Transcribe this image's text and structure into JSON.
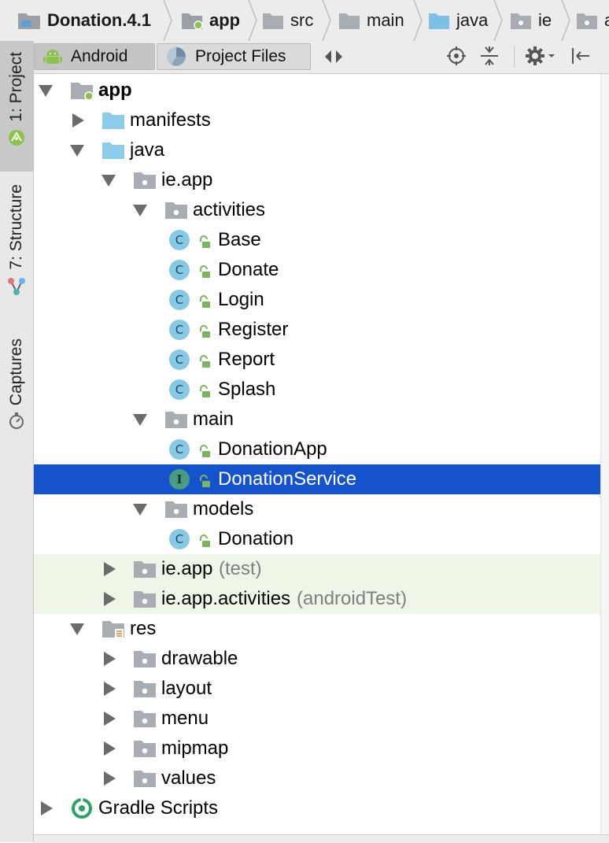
{
  "breadcrumb": [
    {
      "label": "Donation.4.1",
      "icon": "project-folder-icon",
      "bold": true
    },
    {
      "label": "app",
      "icon": "module-folder-icon",
      "bold": true
    },
    {
      "label": "src",
      "icon": "folder-icon",
      "bold": false
    },
    {
      "label": "main",
      "icon": "folder-icon",
      "bold": false
    },
    {
      "label": "java",
      "icon": "source-folder-icon",
      "bold": false
    },
    {
      "label": "ie",
      "icon": "package-icon",
      "bold": false
    },
    {
      "label": "a",
      "icon": "package-icon",
      "bold": false
    }
  ],
  "side_tabs": [
    {
      "label": "1: Project",
      "icon": "android-icon",
      "active": true
    },
    {
      "label": "7: Structure",
      "icon": "structure-icon",
      "active": false
    },
    {
      "label": "Captures",
      "icon": "stopwatch-icon",
      "active": false
    }
  ],
  "toolbar": {
    "view_tabs": [
      {
        "label": "Android",
        "icon": "android-icon",
        "selected": true
      },
      {
        "label": "Project Files",
        "icon": "project-files-icon",
        "selected": false
      }
    ],
    "icons": [
      "switch-view-icon",
      "locate-icon",
      "collapse-all-icon",
      "settings-icon",
      "hide-panel-icon"
    ]
  },
  "tree": [
    {
      "label": "app",
      "bold": true,
      "icon": "module-folder-icon",
      "expand": "down"
    },
    {
      "label": "manifests",
      "icon": "folder-blue-icon",
      "expand": "right"
    },
    {
      "label": "java",
      "icon": "folder-blue-icon",
      "expand": "down"
    },
    {
      "label": "ie.app",
      "icon": "package-icon",
      "expand": "down"
    },
    {
      "label": "activities",
      "icon": "package-icon",
      "expand": "down"
    },
    {
      "label": "Base",
      "icon": "class-icon",
      "expand": "none"
    },
    {
      "label": "Donate",
      "icon": "class-icon",
      "expand": "none"
    },
    {
      "label": "Login",
      "icon": "class-icon",
      "expand": "none"
    },
    {
      "label": "Register",
      "icon": "class-icon",
      "expand": "none"
    },
    {
      "label": "Report",
      "icon": "class-icon",
      "expand": "none"
    },
    {
      "label": "Splash",
      "icon": "class-icon",
      "expand": "none"
    },
    {
      "label": "main",
      "icon": "package-icon",
      "expand": "down"
    },
    {
      "label": "DonationApp",
      "icon": "class-icon",
      "expand": "none"
    },
    {
      "label": "DonationService",
      "icon": "interface-icon",
      "expand": "none",
      "selected": true
    },
    {
      "label": "models",
      "icon": "package-icon",
      "expand": "down"
    },
    {
      "label": "Donation",
      "icon": "class-icon",
      "expand": "none"
    },
    {
      "label": "ie.app",
      "suffix": "(test)",
      "icon": "package-icon",
      "expand": "right",
      "tint": true
    },
    {
      "label": "ie.app.activities",
      "suffix": "(androidTest)",
      "icon": "package-icon",
      "expand": "right",
      "tint": true
    },
    {
      "label": "res",
      "icon": "resource-folder-icon",
      "expand": "down"
    },
    {
      "label": "drawable",
      "icon": "package-icon",
      "expand": "right"
    },
    {
      "label": "layout",
      "icon": "package-icon",
      "expand": "right"
    },
    {
      "label": "menu",
      "icon": "package-icon",
      "expand": "right"
    },
    {
      "label": "mipmap",
      "icon": "package-icon",
      "expand": "right"
    },
    {
      "label": "values",
      "icon": "package-icon",
      "expand": "right"
    },
    {
      "label": "Gradle Scripts",
      "icon": "gradle-icon",
      "expand": "right"
    }
  ],
  "badges": {
    "class": "C",
    "interface": "I"
  },
  "colors": {
    "selection": "#1453cc",
    "class_badge": "#87c9e4",
    "test_tint": "#eef6e8"
  }
}
